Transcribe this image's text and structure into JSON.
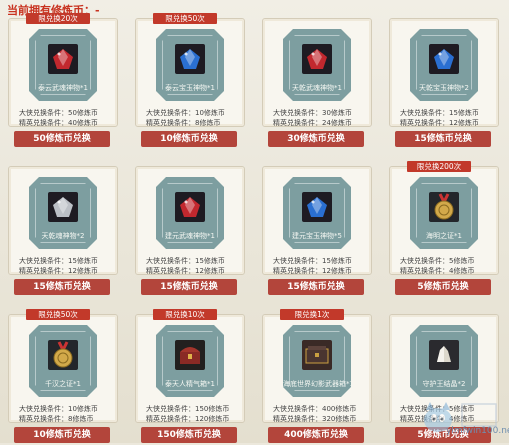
{
  "header": {
    "label": "当前拥有修炼币：-"
  },
  "cards": [
    {
      "limit": "限兑换20次",
      "name": "泰云武魂神物*1",
      "cond1": "大侠兑换条件：50修炼币",
      "cond2": "精英兑换条件：40修炼币",
      "button": "50修炼币兑换",
      "icon": "red-gem-icon",
      "color": "#c2282e"
    },
    {
      "limit": "限兑换50次",
      "name": "泰云宝玉神物*1",
      "cond1": "大侠兑换条件：10修炼币",
      "cond2": "精英兑换条件：8修炼币",
      "button": "10修炼币兑换",
      "icon": "blue-gem-icon",
      "color": "#2a6fd1"
    },
    {
      "limit": "",
      "name": "天乾武魂神物*1",
      "cond1": "大侠兑换条件：30修炼币",
      "cond2": "精英兑换条件：24修炼币",
      "button": "30修炼币兑换",
      "icon": "red-gem-icon",
      "color": "#c2282e"
    },
    {
      "limit": "",
      "name": "天乾宝玉神物*2",
      "cond1": "大侠兑换条件：15修炼币",
      "cond2": "精英兑换条件：12修炼币",
      "button": "15修炼币兑换",
      "icon": "blue-gem-icon",
      "color": "#2a6fd1"
    },
    {
      "limit": "",
      "name": "天乾魂神物*2",
      "cond1": "大侠兑换条件：15修炼币",
      "cond2": "精英兑换条件：12修炼币",
      "button": "15修炼币兑换",
      "icon": "silver-gem-icon",
      "color": "#bcc0c6"
    },
    {
      "limit": "",
      "name": "建元武魂神物*1",
      "cond1": "大侠兑换条件：15修炼币",
      "cond2": "精英兑换条件：12修炼币",
      "button": "15修炼币兑换",
      "icon": "red-gem-icon",
      "color": "#c2282e"
    },
    {
      "limit": "",
      "name": "建元宝玉神物*5",
      "cond1": "大侠兑换条件：15修炼币",
      "cond2": "精英兑换条件：12修炼币",
      "button": "15修炼币兑换",
      "icon": "blue-gem-icon",
      "color": "#2a6fd1"
    },
    {
      "limit": "限兑换200次",
      "name": "海明之证*1",
      "cond1": "大侠兑换条件：5修炼币",
      "cond2": "精英兑换条件：4修炼币",
      "button": "5修炼币兑换",
      "icon": "gold-medal-icon",
      "color": "#c9a041"
    },
    {
      "limit": "限兑换50次",
      "name": "千汉之证*1",
      "cond1": "大侠兑换条件：10修炼币",
      "cond2": "精英兑换条件：8修炼币",
      "button": "10修炼币兑换",
      "icon": "gold-medal-icon",
      "color": "#c9a041"
    },
    {
      "limit": "限兑换10次",
      "name": "泰天人精气箱*1",
      "cond1": "大侠兑换条件：150修炼币",
      "cond2": "精英兑换条件：120修炼币",
      "button": "150修炼币兑换",
      "icon": "chest-icon",
      "color": "#8a2a25"
    },
    {
      "limit": "限兑换1次",
      "name": "海底世界幻影武器箱*1",
      "cond1": "大侠兑换条件：400修炼币",
      "cond2": "精英兑换条件：320修炼币",
      "button": "400修炼币兑换",
      "icon": "case-icon",
      "color": "#4a3530"
    },
    {
      "limit": "",
      "name": "守护王结晶*2",
      "cond1": "大侠兑换条件：5修炼币",
      "cond2": "精英兑换条件：4修炼币",
      "button": "5修炼币兑换",
      "icon": "crystal-icon",
      "color": "#d8d4c8"
    }
  ],
  "watermark": {
    "text": "ylmfwin100.net"
  }
}
